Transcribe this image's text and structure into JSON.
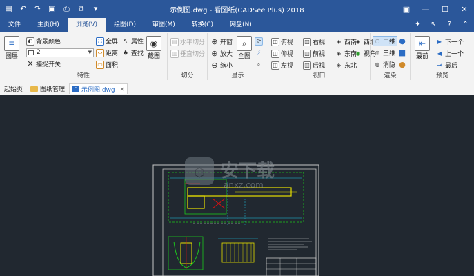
{
  "window": {
    "title": "示例图.dwg - 看图纸(CADSee Plus) 2018",
    "quick_access": [
      "folder-icon",
      "undo-icon",
      "redo-icon",
      "save-icon",
      "print-icon",
      "screenshot-icon",
      "dropdown-icon"
    ],
    "controls": [
      "pin-icon",
      "minimize-icon",
      "maximize-icon",
      "close-icon"
    ]
  },
  "menu": {
    "tabs": [
      {
        "label": "文件"
      },
      {
        "label": "主页(H)"
      },
      {
        "label": "浏览(V)"
      },
      {
        "label": "绘图(D)"
      },
      {
        "label": "审图(M)"
      },
      {
        "label": "转换(C)"
      },
      {
        "label": "网盘(N)"
      }
    ],
    "active_index": 2
  },
  "ribbon": {
    "properties": {
      "label": "特性",
      "layer": "图层",
      "bg_color": "背景颜色",
      "color_value": "2",
      "snap": "捕捉开关",
      "fullscreen": "全屏",
      "attribute": "属性",
      "distance": "距离",
      "find": "查找",
      "area": "面积",
      "screenshot": "截图"
    },
    "split": {
      "label": "切分",
      "horizontal": "水平切分",
      "vertical": "垂直切分"
    },
    "display": {
      "label": "显示",
      "pan": "开窗",
      "zoom_in": "放大",
      "zoom_out": "缩小",
      "full": "全图"
    },
    "viewport": {
      "label": "视口",
      "top": "俯视",
      "right": "右视",
      "sw": "西南",
      "nw": "西北",
      "bottom": "仰视",
      "front": "前视",
      "se": "东南",
      "view": "视角",
      "left": "左视",
      "back": "后视",
      "ne": "东北"
    },
    "render": {
      "label": "渲染",
      "twod": "二维",
      "threed": "三维",
      "hide": "消隐"
    },
    "preview": {
      "label": "预览",
      "latest": "最前",
      "next": "下一个",
      "prev": "上一个",
      "last": "最后"
    }
  },
  "doc_tabs": [
    {
      "label": "起始页"
    },
    {
      "label": "图纸管理"
    },
    {
      "label": "示例图.dwg"
    }
  ],
  "watermark": {
    "text": "安下载",
    "url": "anxz.com"
  },
  "colors": {
    "titlebar": "#2b579a",
    "ribbon_bg": "#f3f3f3",
    "canvas_bg": "#212830",
    "cad_yellow": "#e8e000",
    "cad_green": "#1cc81c",
    "cad_red": "#e01010",
    "cad_cyan": "#20c8e8"
  }
}
